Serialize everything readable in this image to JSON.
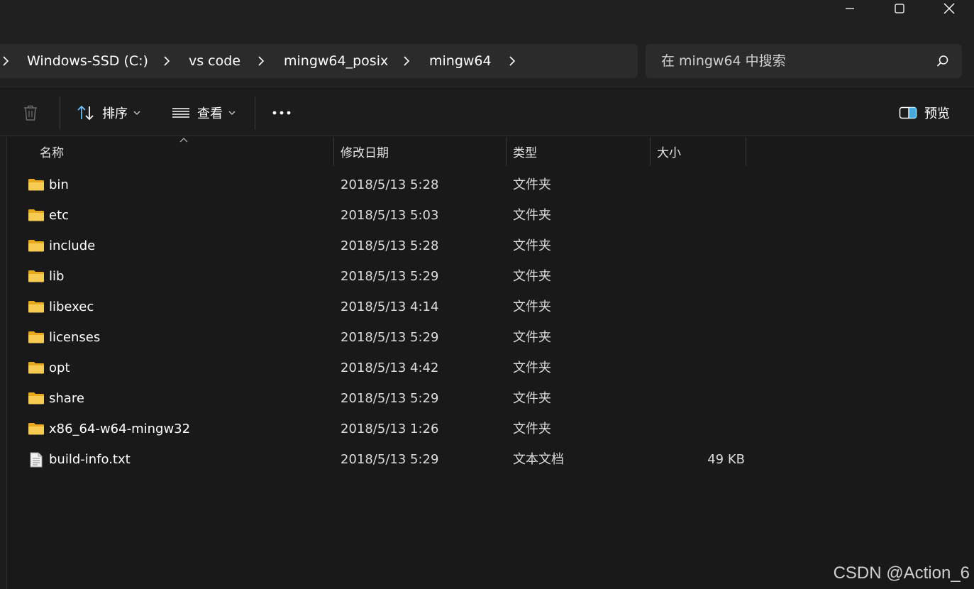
{
  "window": {
    "minimize_icon": "minimize-icon",
    "maximize_icon": "maximize-icon",
    "close_icon": "close-icon"
  },
  "breadcrumb": {
    "items": [
      "Windows-SSD (C:)",
      "vs code",
      "mingw64_posix",
      "mingw64"
    ]
  },
  "search": {
    "placeholder": "在 mingw64 中搜索"
  },
  "toolbar": {
    "sort_label": "排序",
    "view_label": "查看",
    "more_label": "•••",
    "preview_label": "预览"
  },
  "columns": {
    "name": "名称",
    "modified": "修改日期",
    "type": "类型",
    "size": "大小"
  },
  "files": [
    {
      "name": "bin",
      "modified": "2018/5/13 5:28",
      "type": "文件夹",
      "size": "",
      "icon": "folder-icon"
    },
    {
      "name": "etc",
      "modified": "2018/5/13 5:03",
      "type": "文件夹",
      "size": "",
      "icon": "folder-icon"
    },
    {
      "name": "include",
      "modified": "2018/5/13 5:28",
      "type": "文件夹",
      "size": "",
      "icon": "folder-icon"
    },
    {
      "name": "lib",
      "modified": "2018/5/13 5:29",
      "type": "文件夹",
      "size": "",
      "icon": "folder-icon"
    },
    {
      "name": "libexec",
      "modified": "2018/5/13 4:14",
      "type": "文件夹",
      "size": "",
      "icon": "folder-icon"
    },
    {
      "name": "licenses",
      "modified": "2018/5/13 5:29",
      "type": "文件夹",
      "size": "",
      "icon": "folder-icon"
    },
    {
      "name": "opt",
      "modified": "2018/5/13 4:42",
      "type": "文件夹",
      "size": "",
      "icon": "folder-icon"
    },
    {
      "name": "share",
      "modified": "2018/5/13 5:29",
      "type": "文件夹",
      "size": "",
      "icon": "folder-icon"
    },
    {
      "name": "x86_64-w64-mingw32",
      "modified": "2018/5/13 1:26",
      "type": "文件夹",
      "size": "",
      "icon": "folder-icon"
    },
    {
      "name": "build-info.txt",
      "modified": "2018/5/13 5:29",
      "type": "文本文档",
      "size": "49 KB",
      "icon": "text-file-icon"
    }
  ],
  "watermark": "CSDN @Action_6",
  "colors": {
    "background": "#191919",
    "chrome": "#202020",
    "field": "#2b2b2b",
    "folder": "#f4c542",
    "accent": "#4cc2ff"
  }
}
